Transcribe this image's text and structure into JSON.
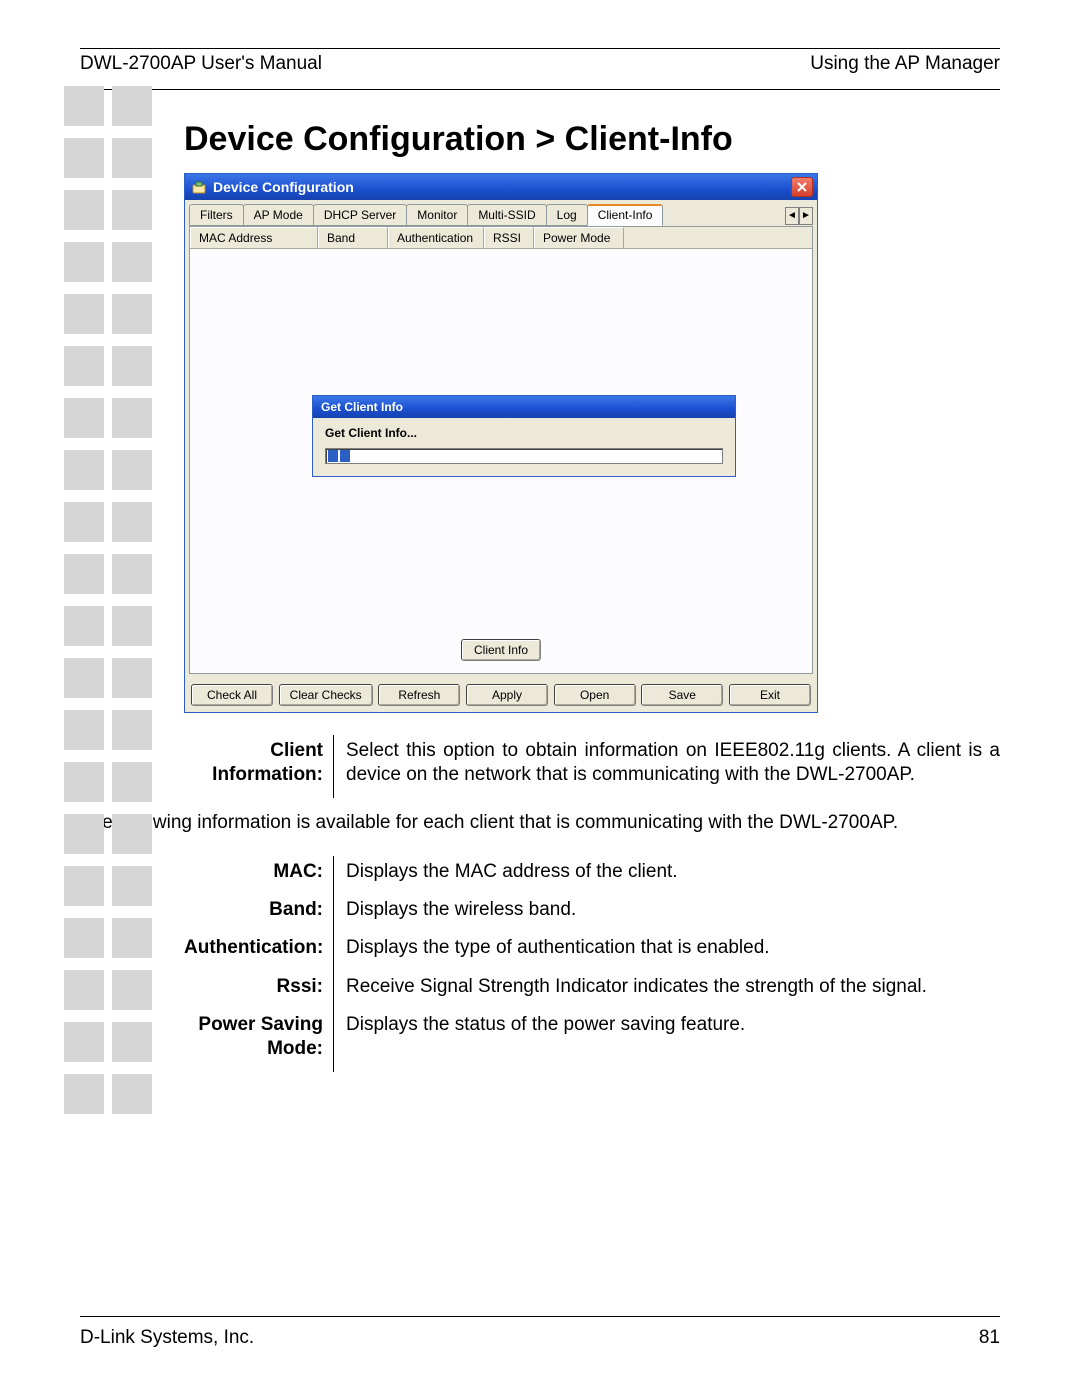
{
  "header": {
    "left": "DWL-2700AP User's Manual",
    "right": "Using the AP Manager"
  },
  "footer": {
    "left": "D-Link Systems, Inc.",
    "right": "81"
  },
  "section_title": "Device Configuration > Client-Info",
  "dialog": {
    "title": "Device Configuration",
    "tabs": [
      "Filters",
      "AP Mode",
      "DHCP Server",
      "Monitor",
      "Multi-SSID",
      "Log",
      "Client-Info"
    ],
    "active_tab": "Client-Info",
    "columns": [
      "MAC Address",
      "Band",
      "Authentication",
      "RSSI",
      "Power Mode"
    ],
    "center_button": "Client Info",
    "bottom_buttons": [
      "Check All",
      "Clear Checks",
      "Refresh",
      "Apply",
      "Open",
      "Save",
      "Exit"
    ],
    "mini": {
      "title": "Get Client Info",
      "body_label": "Get Client Info...",
      "progress_segments": 2
    }
  },
  "descriptions": {
    "rows1": [
      {
        "label": "Client Information:",
        "text": "Select this option to obtain information on IEEE802.11g clients. A client is a device on the network that is communicating with the DWL-2700AP."
      }
    ],
    "paragraph": "The following information is available for each client that is communicating with the DWL-2700AP.",
    "rows2": [
      {
        "label": "MAC:",
        "text": "Displays the MAC address of the client."
      },
      {
        "label": "Band:",
        "text": "Displays the wireless band."
      },
      {
        "label": "Authentication:",
        "text": "Displays the type of authentication that is enabled."
      },
      {
        "label": "Rssi:",
        "text": "Receive Signal Strength Indicator indicates the strength of the signal."
      },
      {
        "label": "Power Saving Mode:",
        "text": "Displays the status of the power saving feature."
      }
    ]
  }
}
